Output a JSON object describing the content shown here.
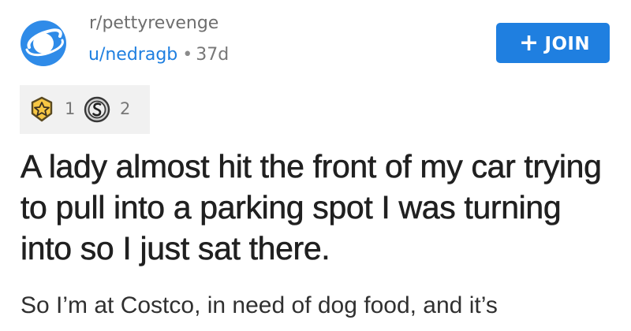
{
  "post": {
    "subreddit": "r/pettyrevenge",
    "username": "u/nedragb",
    "separator": "•",
    "age": "37d",
    "join_button": {
      "icon": "+",
      "label": "JOIN"
    },
    "awards": [
      {
        "icon": "gold-award-icon",
        "count": "1"
      },
      {
        "icon": "silver-award-icon",
        "count": "2"
      }
    ],
    "title": "A lady almost hit the front of my car trying to pull into a parking spot I was turning into so I just sat there.",
    "body_preview": "So I’m at Costco, in need of dog food, and it’s"
  },
  "colors": {
    "accent": "#1f7fe0",
    "avatar_blue": "#2f8be8",
    "award_box": "#f1f1f1",
    "gold": "#f7c744",
    "silver": "#b9b9b9"
  }
}
